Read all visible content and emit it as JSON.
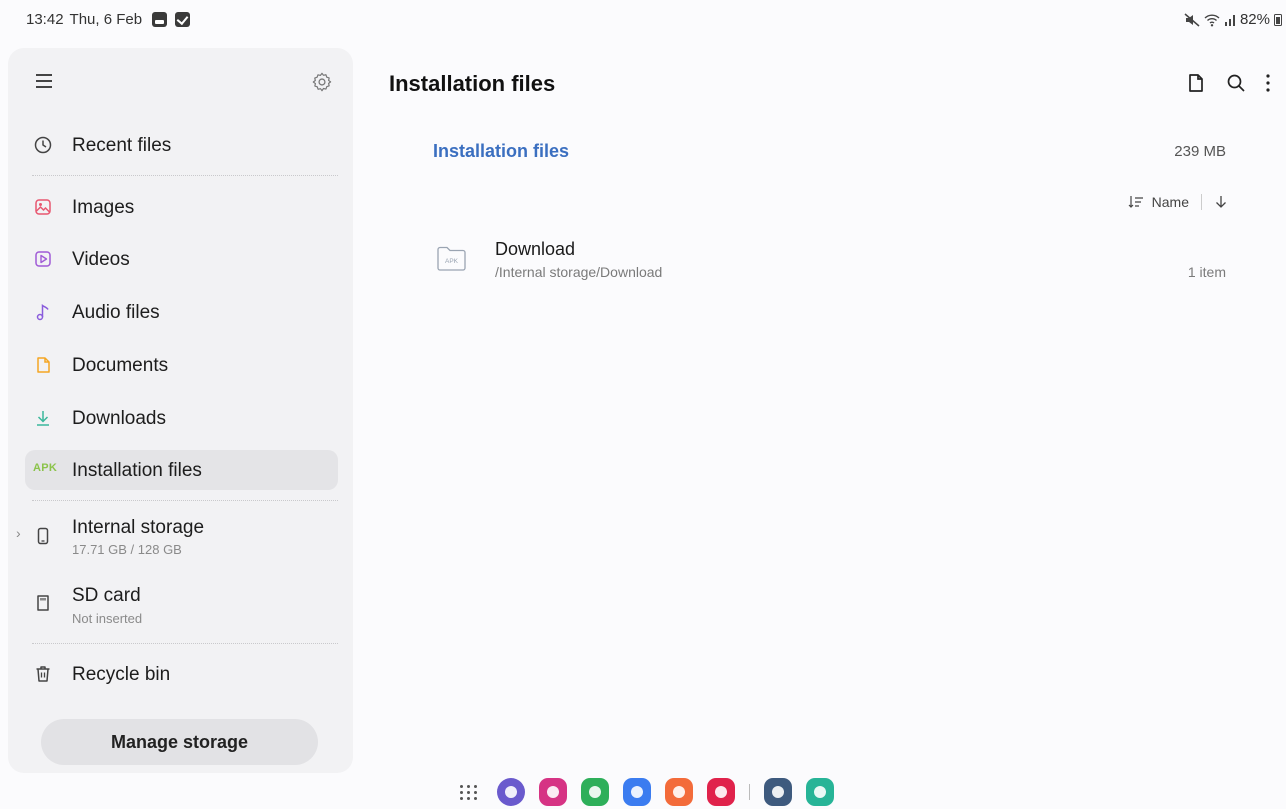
{
  "status_bar": {
    "time": "13:42",
    "date": "Thu, 6 Feb",
    "battery": "82%"
  },
  "sidebar": {
    "items": [
      {
        "label": "Recent files",
        "icon": "clock-icon",
        "color": "#555555"
      },
      {
        "label": "Images",
        "icon": "image-icon",
        "color": "#e8566f"
      },
      {
        "label": "Videos",
        "icon": "video-icon",
        "color": "#a05bd6"
      },
      {
        "label": "Audio files",
        "icon": "music-note-icon",
        "color": "#8a5cdc"
      },
      {
        "label": "Documents",
        "icon": "document-icon",
        "color": "#f5a623"
      },
      {
        "label": "Downloads",
        "icon": "download-icon",
        "color": "#3bb89b"
      },
      {
        "label": "Installation files",
        "icon": "apk-icon",
        "icon_text": "APK",
        "color": "#8bc34a",
        "active": true
      }
    ],
    "storage": [
      {
        "label": "Internal storage",
        "sub": "17.71 GB / 128 GB",
        "icon": "phone-icon"
      },
      {
        "label": "SD card",
        "sub": "Not inserted",
        "icon": "sd-card-icon"
      }
    ],
    "recycle_bin": "Recycle bin",
    "manage_storage": "Manage storage"
  },
  "main": {
    "title": "Installation files",
    "section_title": "Installation files",
    "section_size": "239 MB",
    "sort_label": "Name",
    "files": [
      {
        "name": "Download",
        "path": "/Internal storage/Download",
        "count": "1 item",
        "icon": "folder-icon",
        "icon_text": "APK"
      }
    ]
  },
  "dock": {
    "apps": [
      {
        "name": "internet-app-icon",
        "color": "#6a5acd"
      },
      {
        "name": "gallery-app-icon",
        "color": "#d63384"
      },
      {
        "name": "phone-app-icon",
        "color": "#2eaf5a"
      },
      {
        "name": "messages-app-icon",
        "color": "#3b7cf0"
      },
      {
        "name": "contacts-app-icon",
        "color": "#f36b3a"
      },
      {
        "name": "camera-app-icon",
        "color": "#e0224b"
      },
      {
        "name": "settings-app-icon",
        "color": "#3e5a7e"
      },
      {
        "name": "game-app-icon",
        "color": "#27b497"
      }
    ]
  }
}
